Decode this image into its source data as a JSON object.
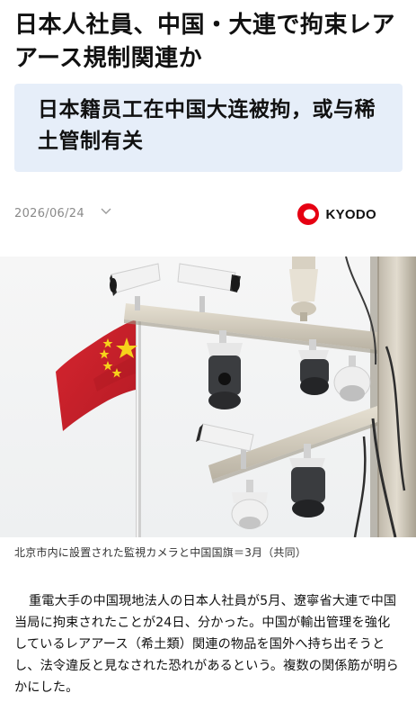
{
  "article": {
    "headline": "日本人社員、中国・大連で拘束レアアース規制関連か",
    "translation": "日本籍员工在中国大连被拘，或与稀土管制有关",
    "date": "2026/06/24",
    "source_logo_text": "KYODO",
    "image_caption": "北京市内に設置された監視カメラと中国国旗＝3月（共同）",
    "body": "重電大手の中国現地法人の日本人社員が5月、遼寧省大連で中国当局に拘束されたことが24日、分かった。中国が輸出管理を強化しているレアアース（希土類）関連の物品を国外へ持ち出そうとし、法令違反と見なされた恐れがあるという。複数の関係筋が明らかにした。"
  },
  "icons": {
    "date_toggle": "chevron-down-icon",
    "logo": "kyodo-logo-icon"
  },
  "colors": {
    "translation_bg": "#e6eef9",
    "logo_red": "#e60012",
    "flag_red": "#c8202b",
    "flag_star": "#f6d21b",
    "muted_text": "#8a8a8a"
  }
}
